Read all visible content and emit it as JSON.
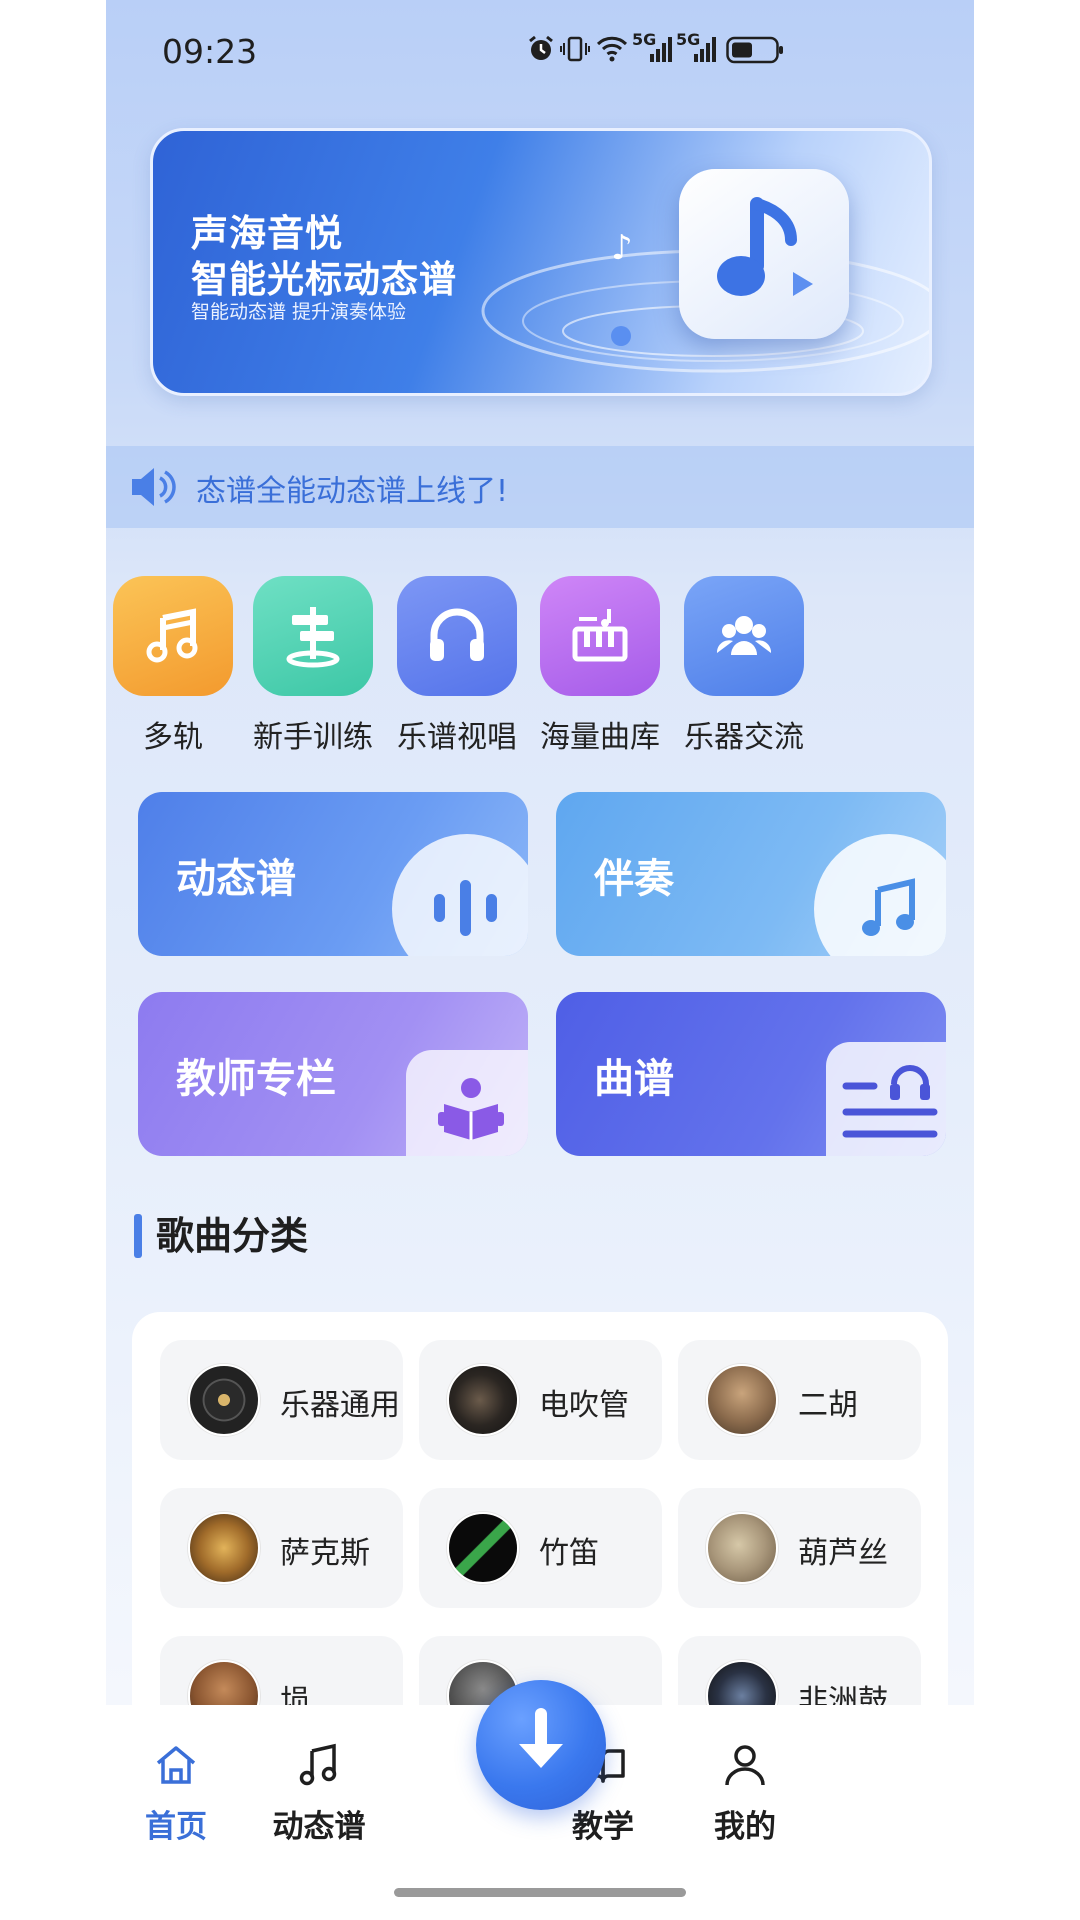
{
  "status_bar": {
    "time": "09:23",
    "icons": [
      "alarm-icon",
      "vibrate-icon",
      "wifi-icon",
      "signal-5g-icon",
      "signal-5g-icon",
      "battery-icon"
    ],
    "network_labels": [
      "5G",
      "5G"
    ]
  },
  "banner": {
    "title_line1": "声海音悦",
    "title_line2": "智能光标动态谱",
    "subtitle": "智能动态谱  提升演奏体验"
  },
  "notice": {
    "text": "态谱全能动态谱上线了!"
  },
  "quick_actions": [
    {
      "label": "多轨",
      "icon": "music-note-icon",
      "color": "#f5a93a"
    },
    {
      "label": "新手训练",
      "icon": "signpost-icon",
      "color": "#4fd1b2"
    },
    {
      "label": "乐谱视唱",
      "icon": "headphones-icon",
      "color": "#5b7cf0"
    },
    {
      "label": "海量曲库",
      "icon": "piano-icon",
      "color": "#b06ef0"
    },
    {
      "label": "乐器交流",
      "icon": "group-icon",
      "color": "#5c8df0"
    }
  ],
  "feature_cards": [
    {
      "label": "动态谱",
      "icon": "audio-bars-icon"
    },
    {
      "label": "伴奏",
      "icon": "music-note-icon"
    },
    {
      "label": "教师专栏",
      "icon": "reader-book-icon"
    },
    {
      "label": "曲谱",
      "icon": "headphone-list-icon"
    }
  ],
  "section": {
    "title": "歌曲分类"
  },
  "categories": [
    {
      "label": "乐器通用"
    },
    {
      "label": "电吹管"
    },
    {
      "label": "二胡"
    },
    {
      "label": "萨克斯"
    },
    {
      "label": "竹笛"
    },
    {
      "label": "葫芦丝"
    },
    {
      "label": "埙"
    },
    {
      "label": ""
    },
    {
      "label": "非洲鼓"
    }
  ],
  "bottom_nav": {
    "items": [
      {
        "label": "首页",
        "icon": "home-icon",
        "active": true
      },
      {
        "label": "动态谱",
        "icon": "music-note-icon",
        "active": false
      },
      {
        "label": "教学",
        "icon": "book-icon",
        "active": false
      },
      {
        "label": "我的",
        "icon": "user-icon",
        "active": false
      }
    ],
    "center_action_icon": "download-arrow-icon"
  },
  "colors": {
    "accent": "#3a6fd8",
    "background_top": "#b9cff7"
  }
}
